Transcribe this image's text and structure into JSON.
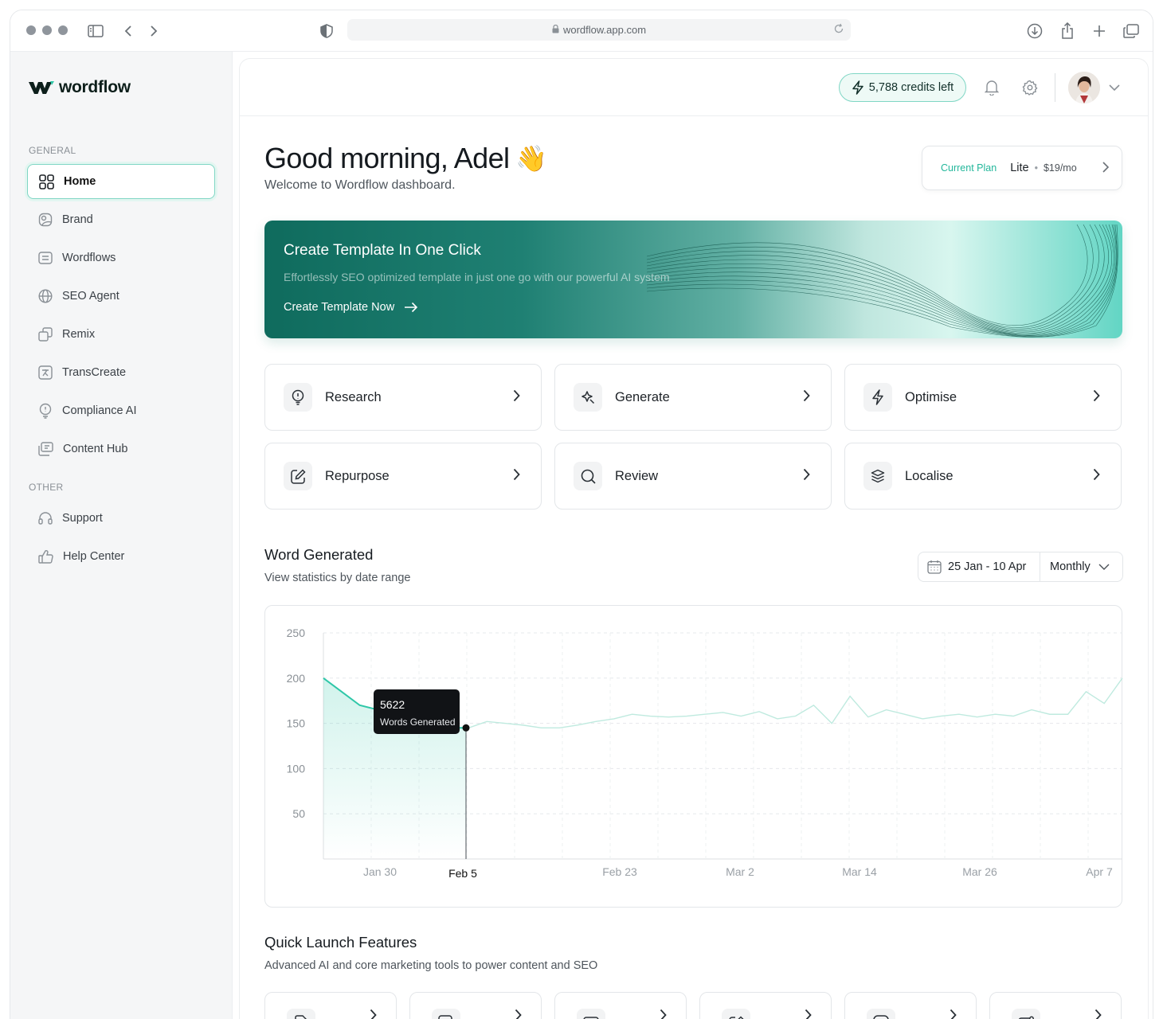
{
  "browser": {
    "url": "wordflow.app.com"
  },
  "brand": {
    "name": "wordflow"
  },
  "sidebar": {
    "general_label": "GENERAL",
    "other_label": "OTHER",
    "items": [
      {
        "label": "Home",
        "icon": "grid-icon"
      },
      {
        "label": "Brand",
        "icon": "brand-icon"
      },
      {
        "label": "Wordflows",
        "icon": "wordflows-icon"
      },
      {
        "label": "SEO Agent",
        "icon": "globe-icon"
      },
      {
        "label": "Remix",
        "icon": "remix-icon"
      },
      {
        "label": "TransCreate",
        "icon": "translate-icon"
      },
      {
        "label": "Compliance AI",
        "icon": "compliance-icon"
      },
      {
        "label": "Content Hub",
        "icon": "content-hub-icon"
      }
    ],
    "other_items": [
      {
        "label": "Support",
        "icon": "headset-icon"
      },
      {
        "label": "Help Center",
        "icon": "thumbs-up-icon"
      }
    ]
  },
  "header": {
    "credits": "5,788 credits left"
  },
  "greeting": {
    "title": "Good morning, Adel",
    "emoji": "👋",
    "subtitle": "Welcome to Wordflow dashboard."
  },
  "plan": {
    "label": "Current Plan",
    "name": "Lite",
    "sep": "•",
    "price": "$19/mo"
  },
  "banner": {
    "title": "Create Template In One Click",
    "description": "Effortlessly SEO optimized template in just one go with our powerful AI system",
    "cta": "Create Template Now"
  },
  "tiles": [
    {
      "label": "Research",
      "icon": "lightbulb-icon"
    },
    {
      "label": "Generate",
      "icon": "sparkle-icon"
    },
    {
      "label": "Optimise",
      "icon": "bolt-icon"
    },
    {
      "label": "Repurpose",
      "icon": "edit-icon"
    },
    {
      "label": "Review",
      "icon": "search-icon"
    },
    {
      "label": "Localise",
      "icon": "layers-icon"
    }
  ],
  "words": {
    "title": "Word Generated",
    "subtitle": "View statistics by date range",
    "range": "25 Jan - 10 Apr",
    "period": "Monthly"
  },
  "chart_data": {
    "type": "line",
    "title": "Word Generated",
    "y_ticks": [
      "250",
      "200",
      "150",
      "100",
      "50"
    ],
    "x_ticks": [
      "Jan 30",
      "Feb 5",
      "Feb 23",
      "Mar 2",
      "Mar 14",
      "Mar 26",
      "Apr 7"
    ],
    "ylim": [
      0,
      250
    ],
    "grid": true,
    "series": [
      {
        "values": [
          200,
          185,
          170,
          165,
          160,
          155,
          150,
          145,
          145,
          152,
          150,
          148,
          145,
          145,
          148,
          152,
          155,
          160,
          158,
          157,
          158,
          160,
          162,
          158,
          163,
          155,
          158,
          170,
          150,
          180,
          157,
          165,
          160,
          155,
          158,
          160,
          157,
          160,
          158,
          165,
          160,
          160,
          185,
          172,
          200
        ]
      }
    ],
    "tooltip": {
      "value": "5622",
      "label": "Words Generated",
      "x": "Feb 5"
    }
  },
  "quick_launch": {
    "title": "Quick Launch Features",
    "subtitle": "Advanced AI and core marketing tools to power content and SEO",
    "items": [
      {
        "icon": "document-icon"
      },
      {
        "icon": "image-edit-icon"
      },
      {
        "icon": "media-icon"
      },
      {
        "icon": "edit-icon"
      },
      {
        "icon": "play-icon"
      },
      {
        "icon": "mail-icon"
      }
    ]
  }
}
